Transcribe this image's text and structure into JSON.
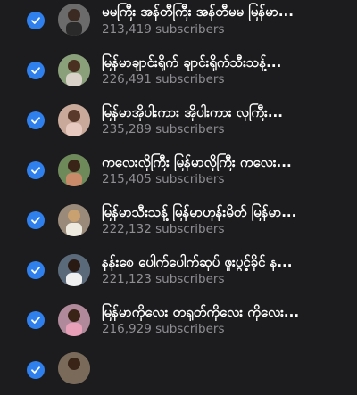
{
  "icons": {
    "check": "checkmark-circle-icon",
    "avatar": "profile-photo"
  },
  "colors": {
    "check_blue": "#2f80ed",
    "background": "#1c1c1e",
    "subtext": "#8e8e93"
  },
  "channels": [
    {
      "name": "မမကြီး အန်တီကြီး အန်တီမမ မြန်မာ...",
      "subscribers": "213,419 subscribers",
      "selected": true
    },
    {
      "name": "မြန်မာချာင်းရိုက် ချာင်းရိုက်သီးသန့်...",
      "subscribers": "226,491 subscribers",
      "selected": true
    },
    {
      "name": "မြန်မာအိုပါးကား အိုပါးကား လှကြီး...",
      "subscribers": "235,289 subscribers",
      "selected": true
    },
    {
      "name": "ကလေးလိုကြီး မြန်မာလိုကြီး ကလေး...",
      "subscribers": "215,405 subscribers",
      "selected": true
    },
    {
      "name": "မြန်မာသီးသန့် မြန်မာဟုန်းမိတ် မြန်မာ...",
      "subscribers": "222,132 subscribers",
      "selected": true
    },
    {
      "name": "နန်းစေ ပေါက်ပေါက်ဆုပ် ဖူးပွင့်ခိုင် န...",
      "subscribers": "221,123 subscribers",
      "selected": true
    },
    {
      "name": "မြန်မာကိုလေး တရုတ်ကိုလေး ကိုလေး...",
      "subscribers": "216,929 subscribers",
      "selected": true
    },
    {
      "name": "",
      "subscribers": "",
      "selected": true
    }
  ]
}
